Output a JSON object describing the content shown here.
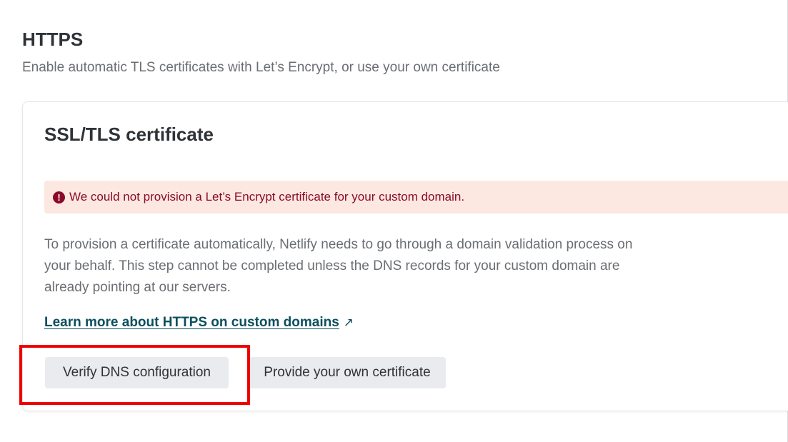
{
  "section": {
    "title": "HTTPS",
    "description": "Enable automatic TLS certificates with Let’s Encrypt, or use your own certificate"
  },
  "card": {
    "title": "SSL/TLS certificate",
    "alert": {
      "icon": "exclamation-circle-icon",
      "text": "We could not provision a Let’s Encrypt certificate for your custom domain."
    },
    "body": "To provision a certificate automatically, Netlify needs to go through a domain validation process on your behalf. This step cannot be completed unless the DNS records for your custom domain are already pointing at our servers.",
    "learn_link": {
      "label": "Learn more about HTTPS on custom domains",
      "icon": "↗"
    },
    "buttons": {
      "verify": "Verify DNS configuration",
      "provide": "Provide your own certificate"
    }
  },
  "colors": {
    "alert_background": "#fde8e1",
    "alert_text": "#8a0a2a",
    "link": "#0b4f5f",
    "highlight": "#ee0000"
  }
}
